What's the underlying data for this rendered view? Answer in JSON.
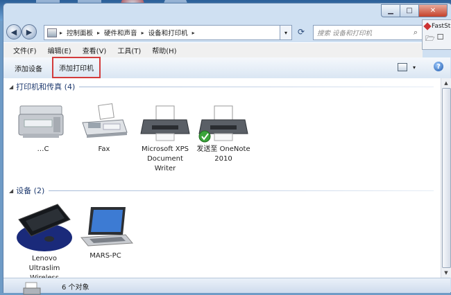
{
  "window": {
    "caption": {
      "minimize": "▁",
      "maximize": "□",
      "close": "✕"
    }
  },
  "nav": {
    "back_icon": "back-arrow-icon",
    "forward_icon": "forward-arrow-icon",
    "breadcrumbs": [
      "控制面板",
      "硬件和声音",
      "设备和打印机"
    ],
    "search_placeholder": "搜索 设备和打印机"
  },
  "faststone": {
    "title": "FastSt"
  },
  "menubar": {
    "items": [
      "文件(F)",
      "编辑(E)",
      "查看(V)",
      "工具(T)",
      "帮助(H)"
    ]
  },
  "commandbar": {
    "add_device": "添加设备",
    "add_printer": "添加打印机"
  },
  "groups": {
    "printers": {
      "title": "打印机和传真 (4)",
      "devices": [
        {
          "label": "…C",
          "icon": "multifunction-printer-icon"
        },
        {
          "label": "Fax",
          "icon": "fax-icon"
        },
        {
          "label": "Microsoft XPS Document Writer",
          "icon": "printer-icon"
        },
        {
          "label": "发送至 OneNote 2010",
          "icon": "printer-icon",
          "default": true
        }
      ]
    },
    "devices": {
      "title": "设备 (2)",
      "devices": [
        {
          "label": "Lenovo Ultraslim Wireless",
          "icon": "keyboard-icon"
        },
        {
          "label": "MARS-PC",
          "icon": "laptop-icon"
        }
      ]
    }
  },
  "status": {
    "text": "6 个对象"
  },
  "colors": {
    "highlight_border": "#d33b3b",
    "group_title": "#1e3a6f"
  }
}
